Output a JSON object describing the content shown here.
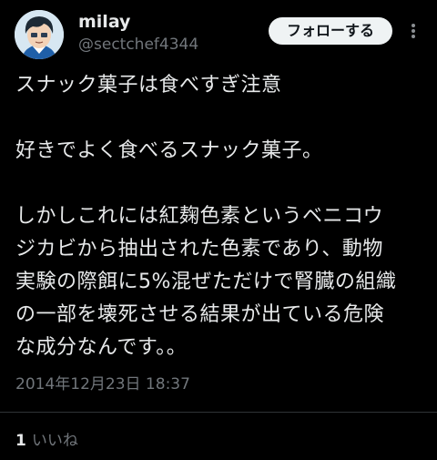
{
  "user": {
    "display_name": "milay",
    "handle": "@sectchef4344",
    "avatar_icon": "anime-boy-avatar"
  },
  "actions": {
    "follow_label": "フォローする",
    "more_icon": "vertical-dots-icon"
  },
  "tweet": {
    "paragraphs": [
      {
        "lines": [
          "スナック菓子は食べすぎ注意"
        ]
      },
      {
        "lines": [
          "好きでよく食べるスナック菓子。"
        ]
      },
      {
        "lines": [
          "しかしこれには紅麹色素というベニコウ",
          "ジカビから抽出された色素であり、動物",
          "実験の際餌に5%混ぜただけで腎臓の組織",
          "の一部を壊死させる結果が出ている危険",
          "な成分なんです。。"
        ]
      }
    ],
    "timestamp": "2014年12月23日 18:37"
  },
  "engagement": {
    "like_count": "1",
    "like_label": "いいね"
  },
  "colors": {
    "background": "#000000",
    "text_primary": "#e7e9ea",
    "text_secondary": "#71767b",
    "follow_button_bg": "#eff3f4",
    "divider": "#2f3336"
  }
}
